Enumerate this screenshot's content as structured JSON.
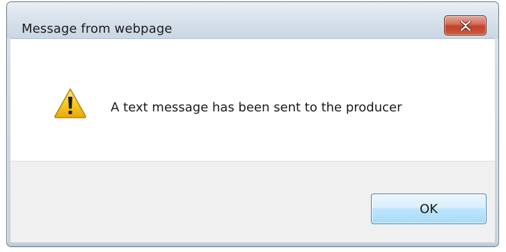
{
  "dialog": {
    "title": "Message from webpage",
    "close_icon": "close-x-icon",
    "message_icon": "warning-icon",
    "message": "A text message has been sent to the producer",
    "ok_label": "OK"
  },
  "colors": {
    "title_bar": "#d8e2ec",
    "close_button": "#c2412a",
    "content_bg": "#ffffff",
    "button_area_bg": "#f0f0f0",
    "ok_button_border": "#3c7fb1",
    "warning_yellow": "#f3c61b"
  }
}
